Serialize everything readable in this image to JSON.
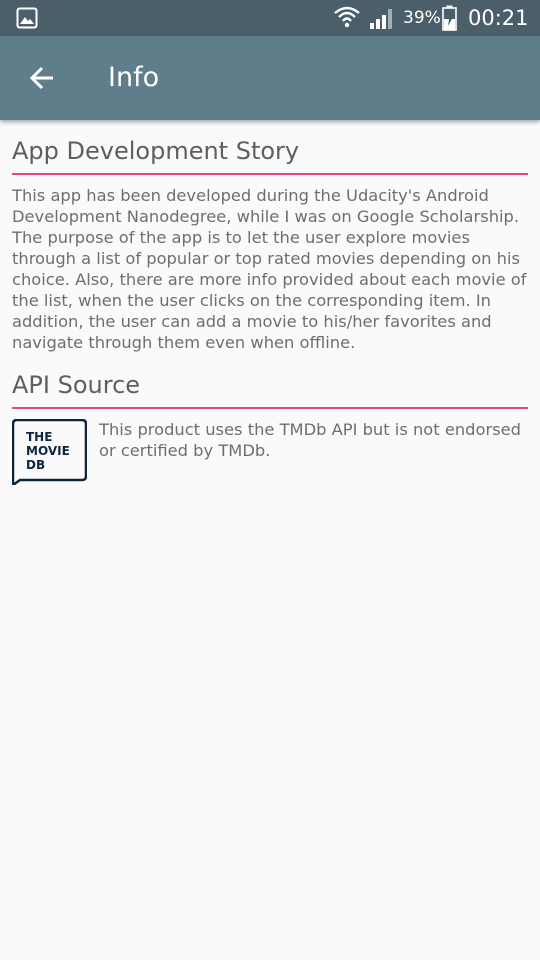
{
  "status_bar": {
    "battery_percent": "39%",
    "time": "00:21",
    "icons": [
      "gallery-icon",
      "wifi-icon",
      "signal-icon",
      "battery-charging-icon"
    ]
  },
  "app_bar": {
    "title": "Info",
    "back_icon": "arrow-left-icon"
  },
  "sections": {
    "story": {
      "title": "App Development Story",
      "body": "This app has been developed during the Udacity's Android Development Nanodegree, while I was on Google Scholarship. The purpose of the app is to let the user explore movies through a list of popular or top rated movies depending on his choice. Also, there are more info provided about each movie of the list, when the user clicks on the corresponding item. In addition, the user can add a movie to his/her favorites and navigate through them even when offline."
    },
    "api": {
      "title": "API Source",
      "body": "This product uses the TMDb API but is not endorsed or certified by TMDb.",
      "logo_lines": [
        "THE",
        "MOVIE",
        "DB"
      ]
    }
  },
  "colors": {
    "status_bar": "#4b5f6b",
    "app_bar": "#607d8b",
    "accent_divider": "#e9457f",
    "background": "#fafafa",
    "heading_text": "#5f5f5f",
    "body_text": "#6e6e6e"
  }
}
